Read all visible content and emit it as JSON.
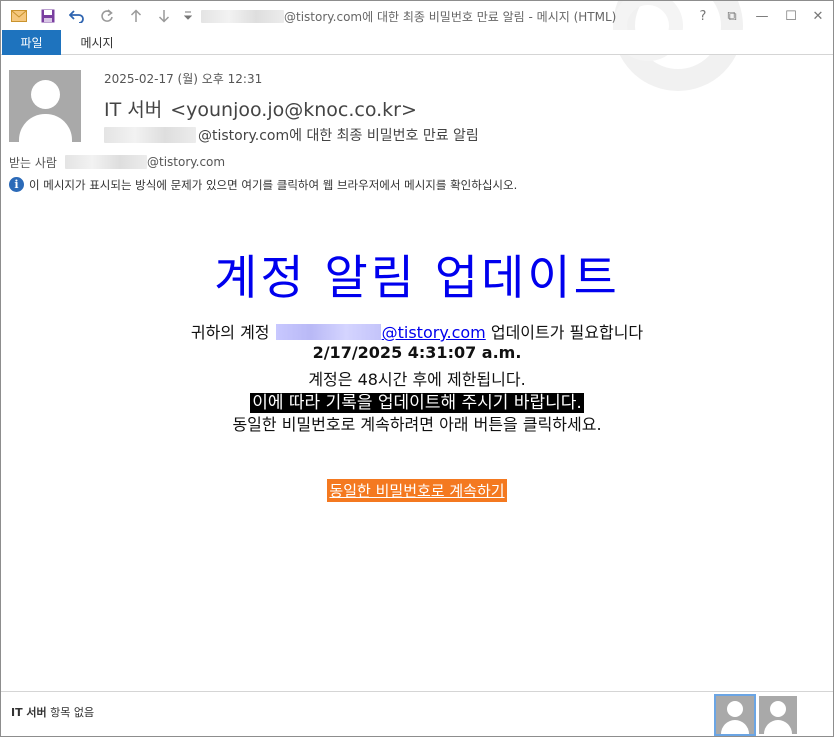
{
  "window": {
    "title_suffix": "@tistory.com에 대한 최종 비밀번호 만료 알림 - 메시지 (HTML)",
    "controls": {
      "help": "?",
      "restore_ribbon": "⧉",
      "minimize": "—",
      "maximize": "☐",
      "close": "✕"
    }
  },
  "quick_access": {
    "icons": [
      "envelope-icon",
      "save-icon",
      "undo-icon",
      "redo-icon",
      "up-arrow-icon",
      "down-arrow-icon",
      "customize-icon"
    ]
  },
  "ribbon": {
    "file_tab": "파일",
    "message_tab": "메시지"
  },
  "header": {
    "date": "2025-02-17 (월) 오후 12:31",
    "sender_name": "IT 서버",
    "sender_email": "<younjoo.jo@knoc.co.kr>",
    "subject": "@tistory.com에 대한 최종 비밀번호 만료 알림",
    "to_label": "받는 사람",
    "to_email": "@tistory.com",
    "info_text": "이 메시지가 표시되는 방식에 문제가 있으면 여기를 클릭하여 웹 브라우저에서 메시지를 확인하십시오."
  },
  "body": {
    "headline": "계정 알림 업데이트",
    "line1_prefix": "귀하의 계정",
    "line1_link": "@tistory.com",
    "line1_suffix": "업데이트가 필요합니다",
    "line2": "2/17/2025 4:31:07 a.m.",
    "line3": "계정은 48시간 후에 제한됩니다.",
    "line4": "이에 따라 기록을 업데이트해 주시기 바랍니다.",
    "line5": "동일한 비밀번호로 계속하려면 아래 버튼을 클릭하세요.",
    "cta": "동일한 비밀번호로 계속하기"
  },
  "people_bar": {
    "name": "IT 서버",
    "status": "항목 없음"
  },
  "colors": {
    "accent": "#1e73be",
    "headline": "#0000ee",
    "cta_bg": "#f47920"
  }
}
